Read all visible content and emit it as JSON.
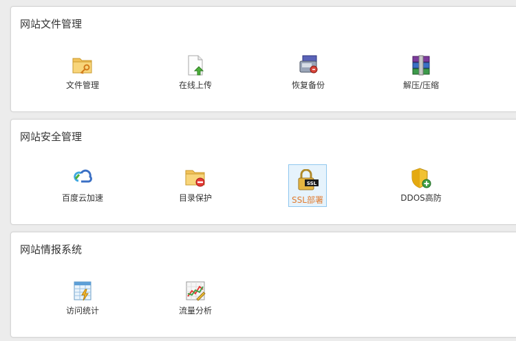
{
  "sections": [
    {
      "title": "网站文件管理",
      "items": [
        {
          "label": "文件管理",
          "icon": "folder-key-icon"
        },
        {
          "label": "在线上传",
          "icon": "upload-file-icon"
        },
        {
          "label": "恢复备份",
          "icon": "backup-restore-icon"
        },
        {
          "label": "解压/压缩",
          "icon": "archive-books-icon"
        }
      ]
    },
    {
      "title": "网站安全管理",
      "items": [
        {
          "label": "百度云加速",
          "icon": "cloud-accelerate-icon"
        },
        {
          "label": "目录保护",
          "icon": "folder-protect-icon"
        },
        {
          "label": "SSL部署",
          "icon": "ssl-lock-icon",
          "selected": true
        },
        {
          "label": "DDOS高防",
          "icon": "shield-plus-icon"
        }
      ]
    },
    {
      "title": "网站情报系统",
      "items": [
        {
          "label": "访问统计",
          "icon": "stats-sheet-icon"
        },
        {
          "label": "流量分析",
          "icon": "traffic-chart-icon"
        }
      ]
    }
  ],
  "colors": {
    "selected_bg": "#e6f3fc",
    "selected_border": "#8ec6ee",
    "selected_text": "#e07b2f"
  }
}
